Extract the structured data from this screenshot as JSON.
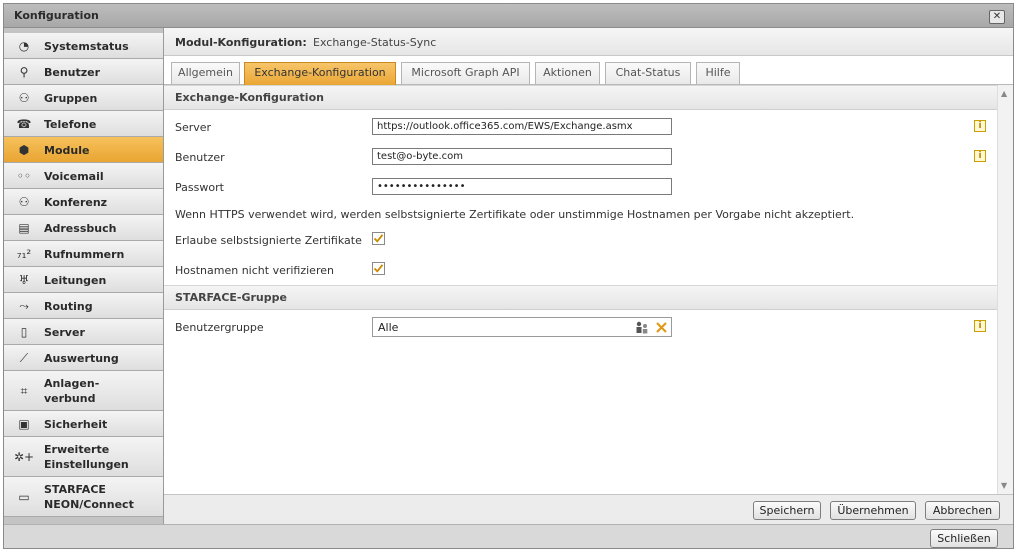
{
  "window": {
    "title": "Konfiguration",
    "close_glyph": "✕"
  },
  "sidebar": {
    "items": [
      {
        "label": "Systemstatus",
        "icon": "clock-icon",
        "glyph": "◔"
      },
      {
        "label": "Benutzer",
        "icon": "user-icon",
        "glyph": "⚲"
      },
      {
        "label": "Gruppen",
        "icon": "group-icon",
        "glyph": "⚇"
      },
      {
        "label": "Telefone",
        "icon": "phone-icon",
        "glyph": "☎"
      },
      {
        "label": "Module",
        "icon": "module-box-icon",
        "glyph": "⬢"
      },
      {
        "label": "Voicemail",
        "icon": "voicemail-icon",
        "glyph": "◦◦"
      },
      {
        "label": "Konferenz",
        "icon": "conference-icon",
        "glyph": "⚇"
      },
      {
        "label": "Adressbuch",
        "icon": "addressbook-icon",
        "glyph": "▤"
      },
      {
        "label": "Rufnummern",
        "icon": "numbers-icon",
        "glyph": "₇₁²"
      },
      {
        "label": "Leitungen",
        "icon": "lines-icon",
        "glyph": "♅"
      },
      {
        "label": "Routing",
        "icon": "routing-icon",
        "glyph": "⤳"
      },
      {
        "label": "Server",
        "icon": "server-icon",
        "glyph": "▯"
      },
      {
        "label": "Auswertung",
        "icon": "chart-icon",
        "glyph": "⟋"
      },
      {
        "label": "Anlagen-\nverbund",
        "icon": "network-icon",
        "glyph": "⌗"
      },
      {
        "label": "Sicherheit",
        "icon": "lock-icon",
        "glyph": "▣"
      },
      {
        "label": "Erweiterte\nEinstellungen",
        "icon": "settings-icon",
        "glyph": "✲+"
      },
      {
        "label": "STARFACE\nNEON/Connect",
        "icon": "video-icon",
        "glyph": "▭"
      }
    ]
  },
  "breadcrumb": {
    "label": "Modul-Konfiguration:",
    "value": "Exchange-Status-Sync"
  },
  "tabs": [
    "Allgemein",
    "Exchange-Konfiguration",
    "Microsoft Graph API",
    "Aktionen",
    "Chat-Status",
    "Hilfe"
  ],
  "exchange": {
    "heading": "Exchange-Konfiguration",
    "server_label": "Server",
    "server_value": "https://outlook.office365.com/EWS/Exchange.asmx",
    "user_label": "Benutzer",
    "user_value": "test@o-byte.com",
    "password_label": "Passwort",
    "password_value": "•••••••••••••••",
    "note": "Wenn HTTPS verwendet wird, werden selbstsignierte Zertifikate oder unstimmige Hostnamen per Vorgabe nicht akzeptiert.",
    "allow_selfsigned_label": "Erlaube selbstsignierte Zertifikate",
    "allow_selfsigned_checked": true,
    "no_verify_label": "Hostnamen nicht verifizieren",
    "no_verify_checked": true
  },
  "group": {
    "heading": "STARFACE-Gruppe",
    "label": "Benutzergruppe",
    "value": "Alle"
  },
  "info_glyph": "i",
  "buttons": {
    "save": "Speichern",
    "apply": "Übernehmen",
    "cancel": "Abbrechen",
    "close": "Schließen"
  }
}
